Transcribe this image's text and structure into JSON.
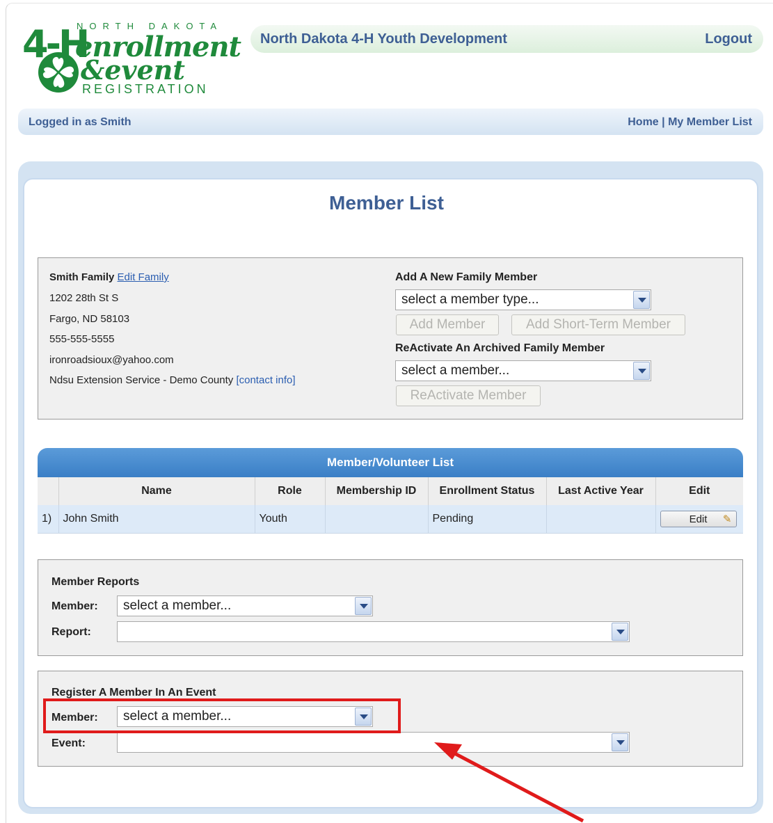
{
  "logo": {
    "fourh": "4-H",
    "top_text": "NORTH DAKOTA",
    "line1": "enrollment",
    "line2": "&event",
    "line3": "REGISTRATION"
  },
  "header": {
    "title": "North Dakota 4-H Youth Development",
    "logout": "Logout"
  },
  "login_bar": {
    "logged_in": "Logged in as Smith",
    "home": "Home",
    "separator": "|",
    "member_list_link": "My Member List"
  },
  "page": {
    "title": "Member List"
  },
  "family": {
    "name": "Smith Family",
    "edit_link": "Edit Family",
    "address": "1202 28th St S",
    "city": "Fargo, ND 58103",
    "phone": "555-555-5555",
    "email": "ironroadsioux@yahoo.com",
    "office": "Ndsu Extension Service - Demo County",
    "contact_link": "[contact info]"
  },
  "add_member": {
    "label": "Add A New Family Member",
    "select_value": "select a member type...",
    "add_button": "Add Member",
    "short_term_button": "Add Short-Term Member"
  },
  "reactivate": {
    "label": "ReActivate An Archived Family Member",
    "select_value": "select a member...",
    "button": "ReActivate Member"
  },
  "member_table": {
    "title": "Member/Volunteer List",
    "columns": [
      "",
      "Name",
      "Role",
      "Membership ID",
      "Enrollment Status",
      "Last Active Year",
      "Edit"
    ],
    "rows": [
      {
        "index": "1)",
        "name": "John Smith",
        "role": "Youth",
        "membership_id": "",
        "status": "Pending",
        "last_active": "",
        "edit": "Edit"
      }
    ]
  },
  "reports": {
    "title": "Member Reports",
    "member_label": "Member:",
    "member_value": "select a member...",
    "report_label": "Report:",
    "report_value": ""
  },
  "register": {
    "title": "Register A Member In An Event",
    "member_label": "Member:",
    "member_value": "select a member...",
    "event_label": "Event:",
    "event_value": ""
  },
  "colors": {
    "brand_green": "#1f8a3b",
    "heading_blue": "#3e5f94",
    "table_header_blue": "#3a7fc6",
    "annotation_red": "#e01b1b"
  }
}
